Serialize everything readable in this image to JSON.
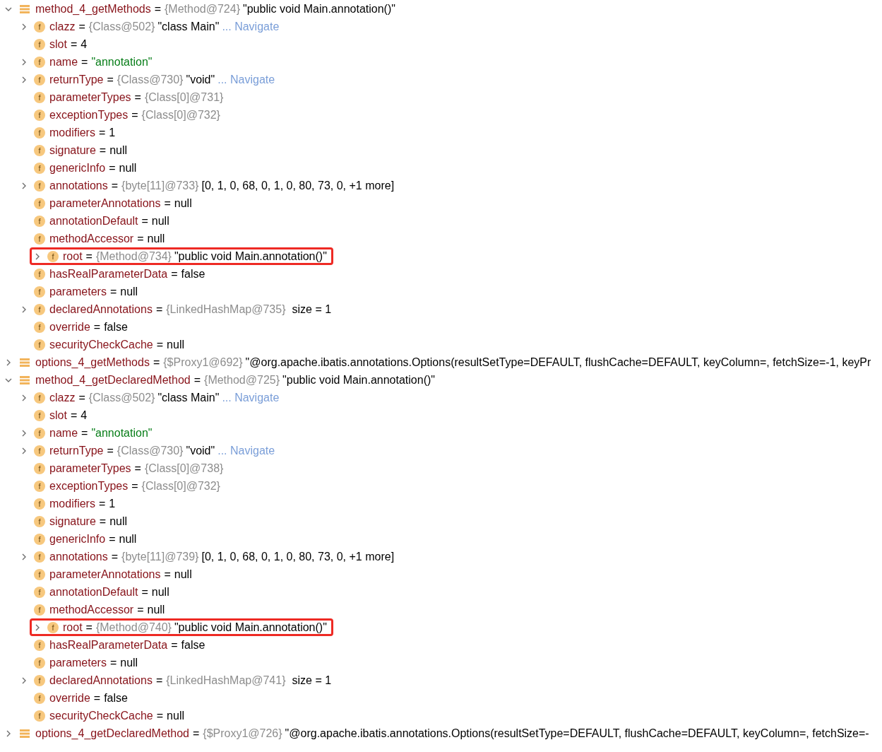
{
  "variables": [
    {
      "kind": "local",
      "name": "method_4_getMethods",
      "op": "=",
      "type": "{Method@724}",
      "value": "\"public void Main.annotation()\"",
      "expanded": true,
      "children": [
        {
          "kind": "field",
          "badge": "f",
          "name": "clazz",
          "op": "=",
          "type": "{Class@502}",
          "value": "\"class Main\"",
          "link": "... Navigate",
          "expanded": false
        },
        {
          "kind": "field",
          "badge": "f",
          "name": "slot",
          "op": "=",
          "value": "4"
        },
        {
          "kind": "field",
          "badge": "f",
          "name": "name",
          "op": "=",
          "value": "\"annotation\"",
          "quoted_string": true,
          "expanded": false
        },
        {
          "kind": "field",
          "badge": "f",
          "name": "returnType",
          "op": "=",
          "type": "{Class@730}",
          "value": "\"void\"",
          "link": "... Navigate",
          "expanded": false
        },
        {
          "kind": "field",
          "badge": "f",
          "name": "parameterTypes",
          "op": "=",
          "type": "{Class[0]@731}"
        },
        {
          "kind": "field",
          "badge": "f",
          "name": "exceptionTypes",
          "op": "=",
          "type": "{Class[0]@732}"
        },
        {
          "kind": "field",
          "badge": "f",
          "name": "modifiers",
          "op": "=",
          "value": "1"
        },
        {
          "kind": "field",
          "badge": "f",
          "name": "signature",
          "op": "=",
          "value": "null"
        },
        {
          "kind": "field",
          "badge": "f",
          "name": "genericInfo",
          "op": "=",
          "value": "null"
        },
        {
          "kind": "field",
          "badge": "f",
          "name": "annotations",
          "op": "=",
          "type": "{byte[11]@733}",
          "value": "[0, 1, 0, 68, 0, 1, 0, 80, 73, 0, +1 more]",
          "expanded": false
        },
        {
          "kind": "field",
          "badge": "f",
          "name": "parameterAnnotations",
          "op": "=",
          "value": "null"
        },
        {
          "kind": "field",
          "badge": "f",
          "name": "annotationDefault",
          "op": "=",
          "value": "null"
        },
        {
          "kind": "field",
          "badge": "f",
          "name": "methodAccessor",
          "op": "=",
          "value": "null"
        },
        {
          "kind": "field",
          "badge": "f",
          "name": "root",
          "op": "=",
          "type": "{Method@734}",
          "value": "\"public void Main.annotation()\"",
          "expanded": false,
          "highlighted": true
        },
        {
          "kind": "field",
          "badge": "f",
          "name": "hasRealParameterData",
          "op": "=",
          "value": "false"
        },
        {
          "kind": "field",
          "badge": "f",
          "name": "parameters",
          "op": "=",
          "value": "null"
        },
        {
          "kind": "field",
          "badge": "f",
          "name": "declaredAnnotations",
          "op": "=",
          "type": "{LinkedHashMap@735}",
          "extra": "size = 1",
          "expanded": false
        },
        {
          "kind": "field",
          "badge": "f",
          "name": "override",
          "op": "=",
          "value": "false"
        },
        {
          "kind": "field",
          "badge": "f",
          "name": "securityCheckCache",
          "op": "=",
          "value": "null"
        }
      ]
    },
    {
      "kind": "local",
      "name": "options_4_getMethods",
      "op": "=",
      "type": "{$Proxy1@692}",
      "value": "\"@org.apache.ibatis.annotations.Options(resultSetType=DEFAULT, flushCache=DEFAULT, keyColumn=, fetchSize=-1, keyPr",
      "expanded": false
    },
    {
      "kind": "local",
      "name": "method_4_getDeclaredMethod",
      "op": "=",
      "type": "{Method@725}",
      "value": "\"public void Main.annotation()\"",
      "expanded": true,
      "children": [
        {
          "kind": "field",
          "badge": "f",
          "name": "clazz",
          "op": "=",
          "type": "{Class@502}",
          "value": "\"class Main\"",
          "link": "... Navigate",
          "expanded": false
        },
        {
          "kind": "field",
          "badge": "f",
          "name": "slot",
          "op": "=",
          "value": "4"
        },
        {
          "kind": "field",
          "badge": "f",
          "name": "name",
          "op": "=",
          "value": "\"annotation\"",
          "quoted_string": true,
          "expanded": false
        },
        {
          "kind": "field",
          "badge": "f",
          "name": "returnType",
          "op": "=",
          "type": "{Class@730}",
          "value": "\"void\"",
          "link": "... Navigate",
          "expanded": false
        },
        {
          "kind": "field",
          "badge": "f",
          "name": "parameterTypes",
          "op": "=",
          "type": "{Class[0]@738}"
        },
        {
          "kind": "field",
          "badge": "f",
          "name": "exceptionTypes",
          "op": "=",
          "type": "{Class[0]@732}"
        },
        {
          "kind": "field",
          "badge": "f",
          "name": "modifiers",
          "op": "=",
          "value": "1"
        },
        {
          "kind": "field",
          "badge": "f",
          "name": "signature",
          "op": "=",
          "value": "null"
        },
        {
          "kind": "field",
          "badge": "f",
          "name": "genericInfo",
          "op": "=",
          "value": "null"
        },
        {
          "kind": "field",
          "badge": "f",
          "name": "annotations",
          "op": "=",
          "type": "{byte[11]@739}",
          "value": "[0, 1, 0, 68, 0, 1, 0, 80, 73, 0, +1 more]",
          "expanded": false
        },
        {
          "kind": "field",
          "badge": "f",
          "name": "parameterAnnotations",
          "op": "=",
          "value": "null"
        },
        {
          "kind": "field",
          "badge": "f",
          "name": "annotationDefault",
          "op": "=",
          "value": "null"
        },
        {
          "kind": "field",
          "badge": "f",
          "name": "methodAccessor",
          "op": "=",
          "value": "null"
        },
        {
          "kind": "field",
          "badge": "f",
          "name": "root",
          "op": "=",
          "type": "{Method@740}",
          "value": "\"public void Main.annotation()\"",
          "expanded": false,
          "highlighted": true
        },
        {
          "kind": "field",
          "badge": "f",
          "name": "hasRealParameterData",
          "op": "=",
          "value": "false"
        },
        {
          "kind": "field",
          "badge": "f",
          "name": "parameters",
          "op": "=",
          "value": "null"
        },
        {
          "kind": "field",
          "badge": "f",
          "name": "declaredAnnotations",
          "op": "=",
          "type": "{LinkedHashMap@741}",
          "extra": "size = 1",
          "expanded": false
        },
        {
          "kind": "field",
          "badge": "f",
          "name": "override",
          "op": "=",
          "value": "false"
        },
        {
          "kind": "field",
          "badge": "f",
          "name": "securityCheckCache",
          "op": "=",
          "value": "null"
        }
      ]
    },
    {
      "kind": "local",
      "name": "options_4_getDeclaredMethod",
      "op": "=",
      "type": "{$Proxy1@726}",
      "value": "\"@org.apache.ibatis.annotations.Options(resultSetType=DEFAULT, flushCache=DEFAULT, keyColumn=, fetchSize=-",
      "expanded": false
    }
  ]
}
